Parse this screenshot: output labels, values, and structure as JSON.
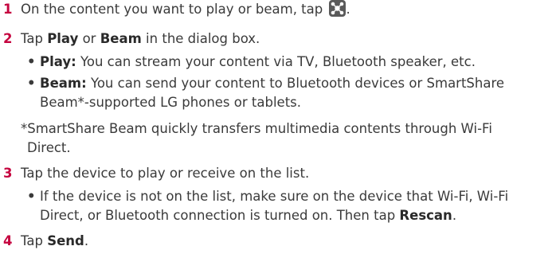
{
  "steps": [
    {
      "number": "1",
      "text_before_icon": "On the content you want to play or beam, tap ",
      "icon": "share-icon",
      "text_after_icon": "."
    },
    {
      "number": "2",
      "text_a": "Tap ",
      "bold_a": "Play",
      "text_b": " or ",
      "bold_b": "Beam",
      "text_c": " in the dialog box."
    },
    {
      "number": "3",
      "text": "Tap the device to play or receive on the list."
    },
    {
      "number": "4",
      "text_a": "Tap ",
      "bold_a": "Send",
      "text_b": "."
    }
  ],
  "step2_bullets": [
    {
      "label": "Play:",
      "text": " You can stream your content via TV, Bluetooth speaker, etc."
    },
    {
      "label": "Beam:",
      "text_line1": " You can send your content to Bluetooth devices or SmartShare",
      "text_line2": "Beam*-supported LG phones or tablets."
    }
  ],
  "footnote": {
    "line1": "*SmartShare Beam quickly transfers multimedia contents through Wi-Fi",
    "line2": "Direct."
  },
  "step3_bullet": {
    "line1": "If the device is not on the list, make sure on the device that Wi-Fi, Wi-Fi",
    "line2_text": "Direct, or Bluetooth connection is turned on. Then tap ",
    "line2_bold": "Rescan",
    "line2_end": "."
  },
  "bullet_char": "•",
  "colors": {
    "step_number": "#c5043f",
    "text": "#3a3a3a",
    "icon_bg": "#5a5a5a"
  }
}
